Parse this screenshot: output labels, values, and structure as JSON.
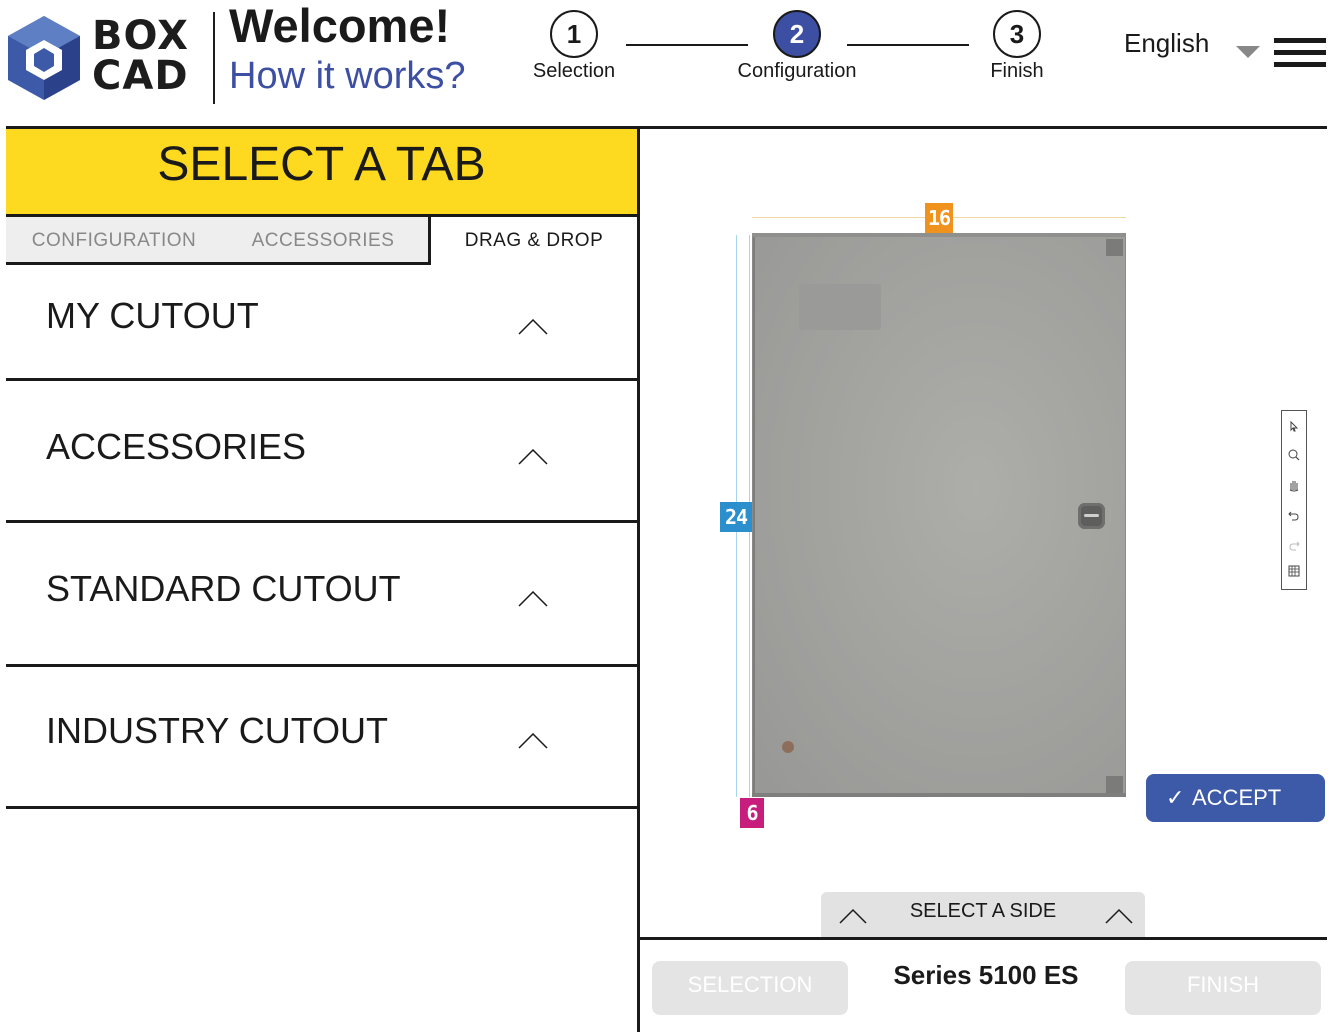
{
  "header": {
    "logo_text": "BOX CAD",
    "welcome": "Welcome!",
    "how_it_works": "How it works?",
    "language": "English",
    "steps": [
      {
        "number": "1",
        "label": "Selection",
        "state": "done"
      },
      {
        "number": "2",
        "label": "Configuration",
        "state": "active"
      },
      {
        "number": "3",
        "label": "Finish",
        "state": "pending"
      }
    ]
  },
  "sidebar": {
    "title": "SELECT A TAB",
    "tabs": [
      {
        "label": "CONFIGURATION",
        "active": false
      },
      {
        "label": "ACCESSORIES",
        "active": false
      },
      {
        "label": "DRAG & DROP",
        "active": true
      }
    ],
    "sections": [
      {
        "label": "MY CUTOUT"
      },
      {
        "label": "ACCESSORIES"
      },
      {
        "label": "STANDARD CUTOUT"
      },
      {
        "label": "INDUSTRY CUTOUT"
      }
    ]
  },
  "viewer": {
    "dimensions": {
      "width": "16",
      "height": "24",
      "depth": "6"
    },
    "tools": [
      "select-icon",
      "zoom-icon",
      "pan-icon",
      "undo-icon",
      "redo-icon",
      "grid-icon"
    ],
    "accept_label": "ACCEPT",
    "select_side_label": "SELECT A SIDE"
  },
  "footer": {
    "prev_label": "SELECTION",
    "series": "Series 5100 ES",
    "next_label": "FINISH"
  },
  "colors": {
    "accent_blue": "#3d4fa3",
    "tab_yellow": "#fdd91f",
    "dim_orange": "#f0921e",
    "dim_blue": "#2b8fcd",
    "dim_magenta": "#c71e7d"
  }
}
